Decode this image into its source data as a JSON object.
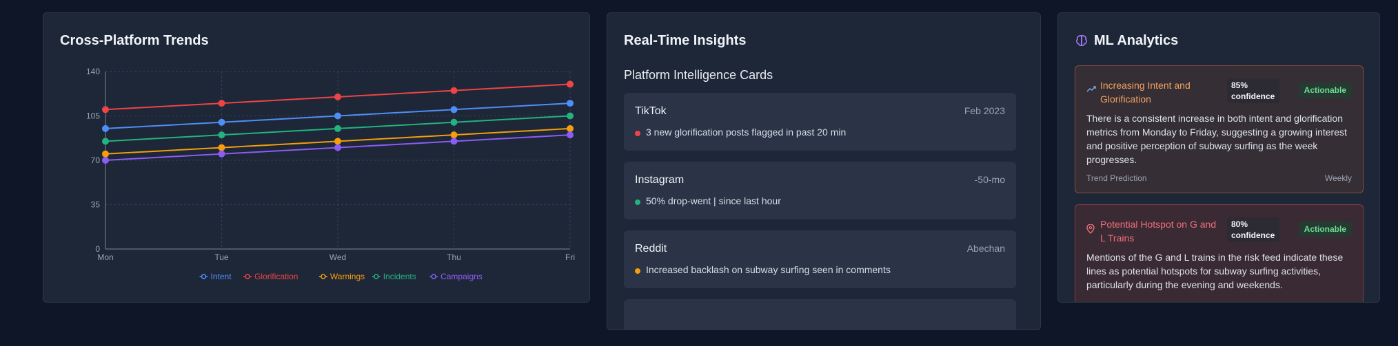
{
  "trends": {
    "title": "Cross-Platform Trends"
  },
  "chart_data": {
    "type": "line",
    "x": [
      "Mon",
      "Tue",
      "Wed",
      "Thu",
      "Fri"
    ],
    "ylim": [
      0,
      140
    ],
    "yticks": [
      0,
      35,
      70,
      105,
      140
    ],
    "grid": true,
    "legend_position": "bottom-center",
    "series": [
      {
        "name": "Intent",
        "color": "#4f8ef7",
        "values": [
          95,
          100,
          105,
          110,
          115
        ]
      },
      {
        "name": "Glorification",
        "color": "#ef4444",
        "values": [
          110,
          115,
          120,
          125,
          130
        ]
      },
      {
        "name": "Warnings",
        "color": "#f59e0b",
        "values": [
          75,
          80,
          85,
          90,
          95
        ]
      },
      {
        "name": "Incidents",
        "color": "#22b37e",
        "values": [
          85,
          90,
          95,
          100,
          105
        ]
      },
      {
        "name": "Campaigns",
        "color": "#8b5cf6",
        "values": [
          70,
          75,
          80,
          85,
          90
        ]
      }
    ]
  },
  "insights": {
    "title": "Real-Time Insights",
    "subtitle": "Platform Intelligence Cards",
    "cards": [
      {
        "platform": "TikTok",
        "time": "Feb 2023",
        "text": "3 new glorification posts flagged in past 20 min",
        "dot_color": "#ef4444"
      },
      {
        "platform": "Instagram",
        "time": "-50-mo",
        "text": "50% drop-went | since last hour",
        "dot_color": "#22b37e"
      },
      {
        "platform": "Reddit",
        "time": "Abechan",
        "text": "Increased backlash on subway surfing seen in comments",
        "dot_color": "#f59e0b"
      }
    ]
  },
  "ml": {
    "title": "ML Analytics",
    "icon": "brain-icon",
    "cards": [
      {
        "title": "Increasing Intent and Glorification",
        "icon": "trending-up-icon",
        "confidence": "85% confidence",
        "badge": "Actionable",
        "desc": "There is a consistent increase in both intent and glorification metrics from Monday to Friday, suggesting a growing interest and positive perception of subway surfing as the week progresses.",
        "type": "Trend Prediction",
        "freq": "Weekly"
      },
      {
        "title": "Potential Hotspot on G and L Trains",
        "icon": "map-pin-icon",
        "confidence": "80% confidence",
        "badge": "Actionable",
        "desc": "Mentions of the G and L trains in the risk feed indicate these lines as potential hotspots for subway surfing activities, particularly during the evening and weekends."
      }
    ]
  }
}
